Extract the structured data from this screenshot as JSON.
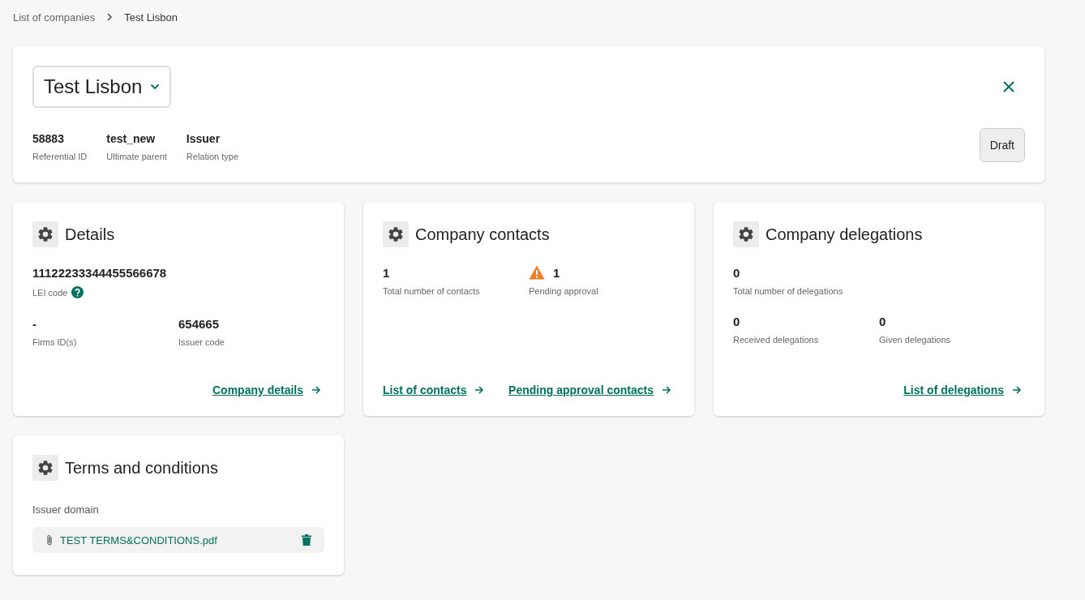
{
  "breadcrumb": [
    {
      "label": "List of companies",
      "current": false
    },
    {
      "label": "Test Lisbon",
      "current": true
    }
  ],
  "header": {
    "company": "Test Lisbon",
    "facts": [
      {
        "value": "58883",
        "label": "Referential ID"
      },
      {
        "value": "test_new",
        "label": "Ultimate parent"
      },
      {
        "value": "Issuer",
        "label": "Relation type"
      }
    ],
    "status": "Draft"
  },
  "cards": [
    {
      "kind": "stats",
      "title": "Details",
      "rows": [
        [
          {
            "value": "11122233344455566678",
            "label": "LEI code",
            "help": true
          }
        ],
        [
          {
            "value": "-",
            "label": "Firms ID(s)"
          },
          {
            "value": "654665",
            "label": "Issuer code"
          }
        ]
      ],
      "links": [
        "Company details"
      ]
    },
    {
      "kind": "stats",
      "title": "Company contacts",
      "rows": [
        [
          {
            "value": "1",
            "label": "Total number of contacts"
          },
          {
            "value": "1",
            "label": "Pending approval",
            "warning": true
          }
        ]
      ],
      "links": [
        "List of contacts",
        "Pending approval contacts"
      ]
    },
    {
      "kind": "stats",
      "title": "Company delegations",
      "rows": [
        [
          {
            "value": "0",
            "label": "Total number of delegations"
          }
        ],
        [
          {
            "value": "0",
            "label": "Received delegations"
          },
          {
            "value": "0",
            "label": "Given delegations"
          }
        ]
      ],
      "links": [
        "List of delegations"
      ]
    },
    {
      "kind": "files",
      "title": "Terms and conditions",
      "section": "Issuer domain",
      "files": [
        "TEST TERMS&CONDITIONS.pdf"
      ]
    }
  ]
}
